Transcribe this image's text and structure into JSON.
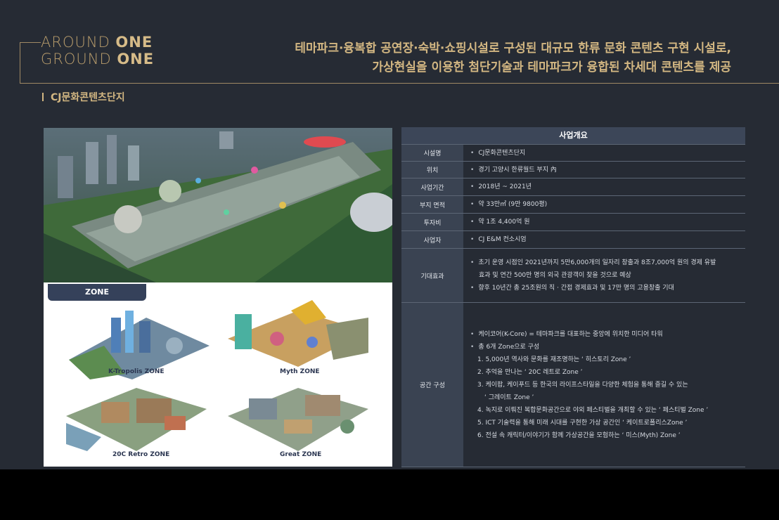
{
  "logo": {
    "line1_a": "A",
    "line1_b": "ROUND ",
    "line1_c": "ONE",
    "line2_a": "G",
    "line2_b": "ROUND ",
    "line2_c": "ONE"
  },
  "headline": {
    "line1": "테마파크·융복합 공연장·숙박·쇼핑시설로 구성된 대규모 한류 문화 콘텐츠 구현 시설로,",
    "line2": "가상현실을 이용한 첨단기술과 테마파크가 융합된 차세대 콘텐츠를 제공"
  },
  "section_title": "CJ문화콘텐츠단지",
  "zone": {
    "tab": "ZONE",
    "tiles": [
      {
        "label": "K-Tropolis ZONE"
      },
      {
        "label": "Myth ZONE"
      },
      {
        "label": "20C Retro ZONE"
      },
      {
        "label": "Great ZONE"
      }
    ]
  },
  "table": {
    "header": "사업개요",
    "rows": [
      {
        "label": "시설명",
        "lines": [
          "CJ문화콘텐츠단지"
        ]
      },
      {
        "label": "위치",
        "lines": [
          "경기 고양시 한류월드 부지 內"
        ]
      },
      {
        "label": "사업기간",
        "lines": [
          "2018년 ~ 2021년"
        ]
      },
      {
        "label": "부지 면적",
        "lines": [
          "약 33만㎡ (9만 9800평)"
        ]
      },
      {
        "label": "투자비",
        "lines": [
          "약 1조 4,400억 원"
        ]
      },
      {
        "label": "사업자",
        "lines": [
          "CJ E&M 컨소시엄"
        ]
      },
      {
        "label": "기대효과",
        "lines": [
          "초기 운영 시점인 2021년까지 5만6,000개의 일자리 창출과 8조7,000억 원의 경제 유발",
          "효과 및 연간 500만 명의 외국 관광객이 찾을 것으로 예상",
          "향후 10년간 총 25조원의 직 · 간접 경제효과 및 17만 명의 고용창출 기대"
        ]
      },
      {
        "label": "공간 구성",
        "lines": [
          "케이코어(K-Core) = 테마파크를 대표하는 중앙에 위치한 미디어 타워",
          "총 6개 Zone으로 구성",
          "1. 5,000년 역사와 문화를 재조명하는 ‘ 히스토리 Zone ’",
          "2. 추억을 만나는 ‘ 20C 레트로 Zone ’",
          "3. 케이팝, 케이푸드 등 한국의 라이프스타일을 다양한 체험을 통해 즐길 수 있는",
          "‘ 그레이트 Zone ’",
          "4. 녹지로 이뤄진 복합문화공간으로 야외 페스티벌을 개최할 수 있는 ‘ 페스티벌 Zone ’",
          "5. ICT 기술력을 통해 미래 시대를 구현한 가상 공간인 ‘ 케이트로폴리스Zone ’",
          "6. 전설 속 캐릭터/이야기가 함께 가상공간을 모험하는 ‘ 미스(Myth) Zone ’"
        ]
      }
    ]
  }
}
